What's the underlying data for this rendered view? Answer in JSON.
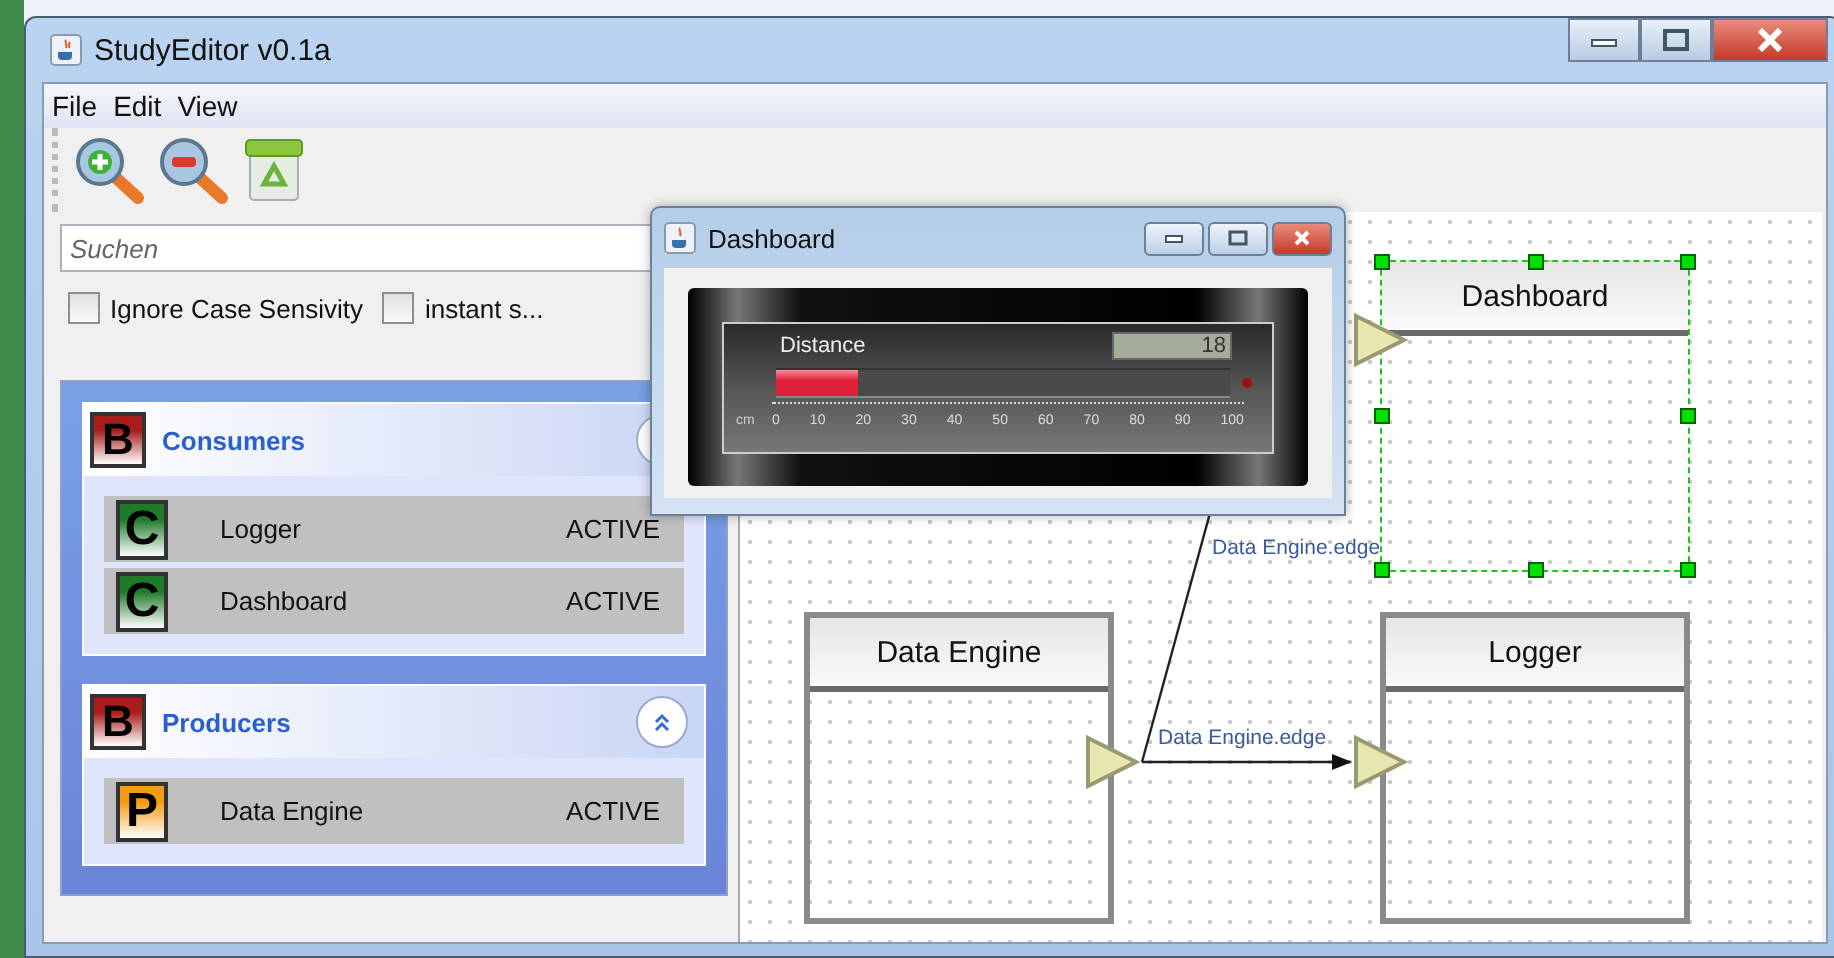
{
  "window": {
    "title": "StudyEditor v0.1a"
  },
  "menu": [
    "File",
    "Edit",
    "View"
  ],
  "search": {
    "placeholder": "Suchen"
  },
  "options": [
    {
      "label": "Ignore Case Sensivity",
      "checked": false
    },
    {
      "label": "instant s...",
      "checked": false
    }
  ],
  "groups": [
    {
      "badge": "B",
      "title": "Consumers",
      "expanded": true,
      "items": [
        {
          "badge": "C",
          "kind": "consumer",
          "name": "Logger",
          "status": "ACTIVE"
        },
        {
          "badge": "C",
          "kind": "consumer",
          "name": "Dashboard",
          "status": "ACTIVE"
        }
      ]
    },
    {
      "badge": "B",
      "title": "Producers",
      "expanded": true,
      "items": [
        {
          "badge": "P",
          "kind": "producer",
          "name": "Data Engine",
          "status": "ACTIVE"
        }
      ]
    }
  ],
  "dashboard_window": {
    "title": "Dashboard",
    "gauge": {
      "label": "Distance",
      "reading": "18",
      "level": 0.18,
      "unit": "cm",
      "scale": [
        "0",
        "10",
        "20",
        "30",
        "40",
        "50",
        "60",
        "70",
        "80",
        "90",
        "100"
      ]
    }
  },
  "canvas": {
    "nodes": [
      {
        "title": "Dashboard",
        "selected": true
      },
      {
        "title": "Data Engine",
        "selected": false
      },
      {
        "title": "Logger",
        "selected": false
      }
    ],
    "edges": [
      {
        "label": "Data Engine.edge"
      },
      {
        "label": "Data Engine.edge"
      }
    ]
  }
}
